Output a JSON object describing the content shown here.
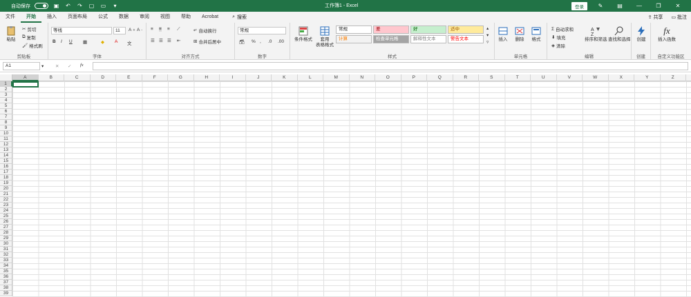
{
  "titlebar": {
    "autosave_label": "自动保存",
    "autosave_state": "关",
    "title": "工作簿1  -  Excel",
    "signin": "登录"
  },
  "tabs": [
    "文件",
    "开始",
    "插入",
    "页面布局",
    "公式",
    "数据",
    "审阅",
    "视图",
    "帮助",
    "Acrobat"
  ],
  "search_label": "搜索",
  "share_label": "共享",
  "comments_label": "批注",
  "ribbon": {
    "clipboard": {
      "label": "剪贴板",
      "paste": "粘贴",
      "cut": "剪切",
      "copy": "复制",
      "painter": "格式刷"
    },
    "font": {
      "label": "字体",
      "name": "等线",
      "size": "11"
    },
    "align": {
      "label": "对齐方式",
      "wrap": "自动换行",
      "merge": "合并后居中"
    },
    "number": {
      "label": "数字",
      "format": "常规"
    },
    "styles": {
      "label": "样式",
      "cond": "条件格式",
      "table": "套用\n表格格式",
      "cells": [
        {
          "text": "常规",
          "bg": "#ffffff",
          "fg": "#222222"
        },
        {
          "text": "差",
          "bg": "#ffc7ce",
          "fg": "#9c0006"
        },
        {
          "text": "好",
          "bg": "#c6efce",
          "fg": "#006100"
        },
        {
          "text": "适中",
          "bg": "#ffeb9c",
          "fg": "#9c5700"
        },
        {
          "text": "计算",
          "bg": "#f2f2f2",
          "fg": "#fa7d00"
        },
        {
          "text": "检查单元格",
          "bg": "#a5a5a5",
          "fg": "#ffffff"
        },
        {
          "text": "解释性文本",
          "bg": "#ffffff",
          "fg": "#7f7f7f"
        },
        {
          "text": "警告文本",
          "bg": "#ffffff",
          "fg": "#ff0000"
        }
      ]
    },
    "cells_group": {
      "label": "单元格",
      "insert": "插入",
      "delete": "删除",
      "format": "格式"
    },
    "editing": {
      "label": "编辑",
      "autosum": "自动求和",
      "fill": "填充",
      "clear": "清除",
      "sort": "排序和筛选",
      "find": "查找和选择"
    },
    "create": {
      "label": "创建",
      "create_btn": "创建"
    },
    "custom": {
      "label": "自定义功能区",
      "insert_fn": "插入函数"
    }
  },
  "namebox": "A1",
  "columns": [
    "A",
    "B",
    "C",
    "D",
    "E",
    "F",
    "G",
    "H",
    "I",
    "J",
    "K",
    "L",
    "M",
    "N",
    "O",
    "P",
    "Q",
    "R",
    "S",
    "T",
    "U",
    "V",
    "W",
    "X",
    "Y",
    "Z"
  ],
  "rows": [
    "1",
    "2",
    "3",
    "4",
    "5",
    "6",
    "7",
    "8",
    "9",
    "10",
    "11",
    "12",
    "13",
    "14",
    "15",
    "16",
    "17",
    "18",
    "19",
    "20",
    "21",
    "22",
    "23",
    "24",
    "25",
    "26",
    "27",
    "28",
    "29",
    "30",
    "31",
    "32",
    "33",
    "34",
    "35",
    "36",
    "37",
    "38",
    "39"
  ],
  "colors": {
    "brand": "#217346"
  }
}
